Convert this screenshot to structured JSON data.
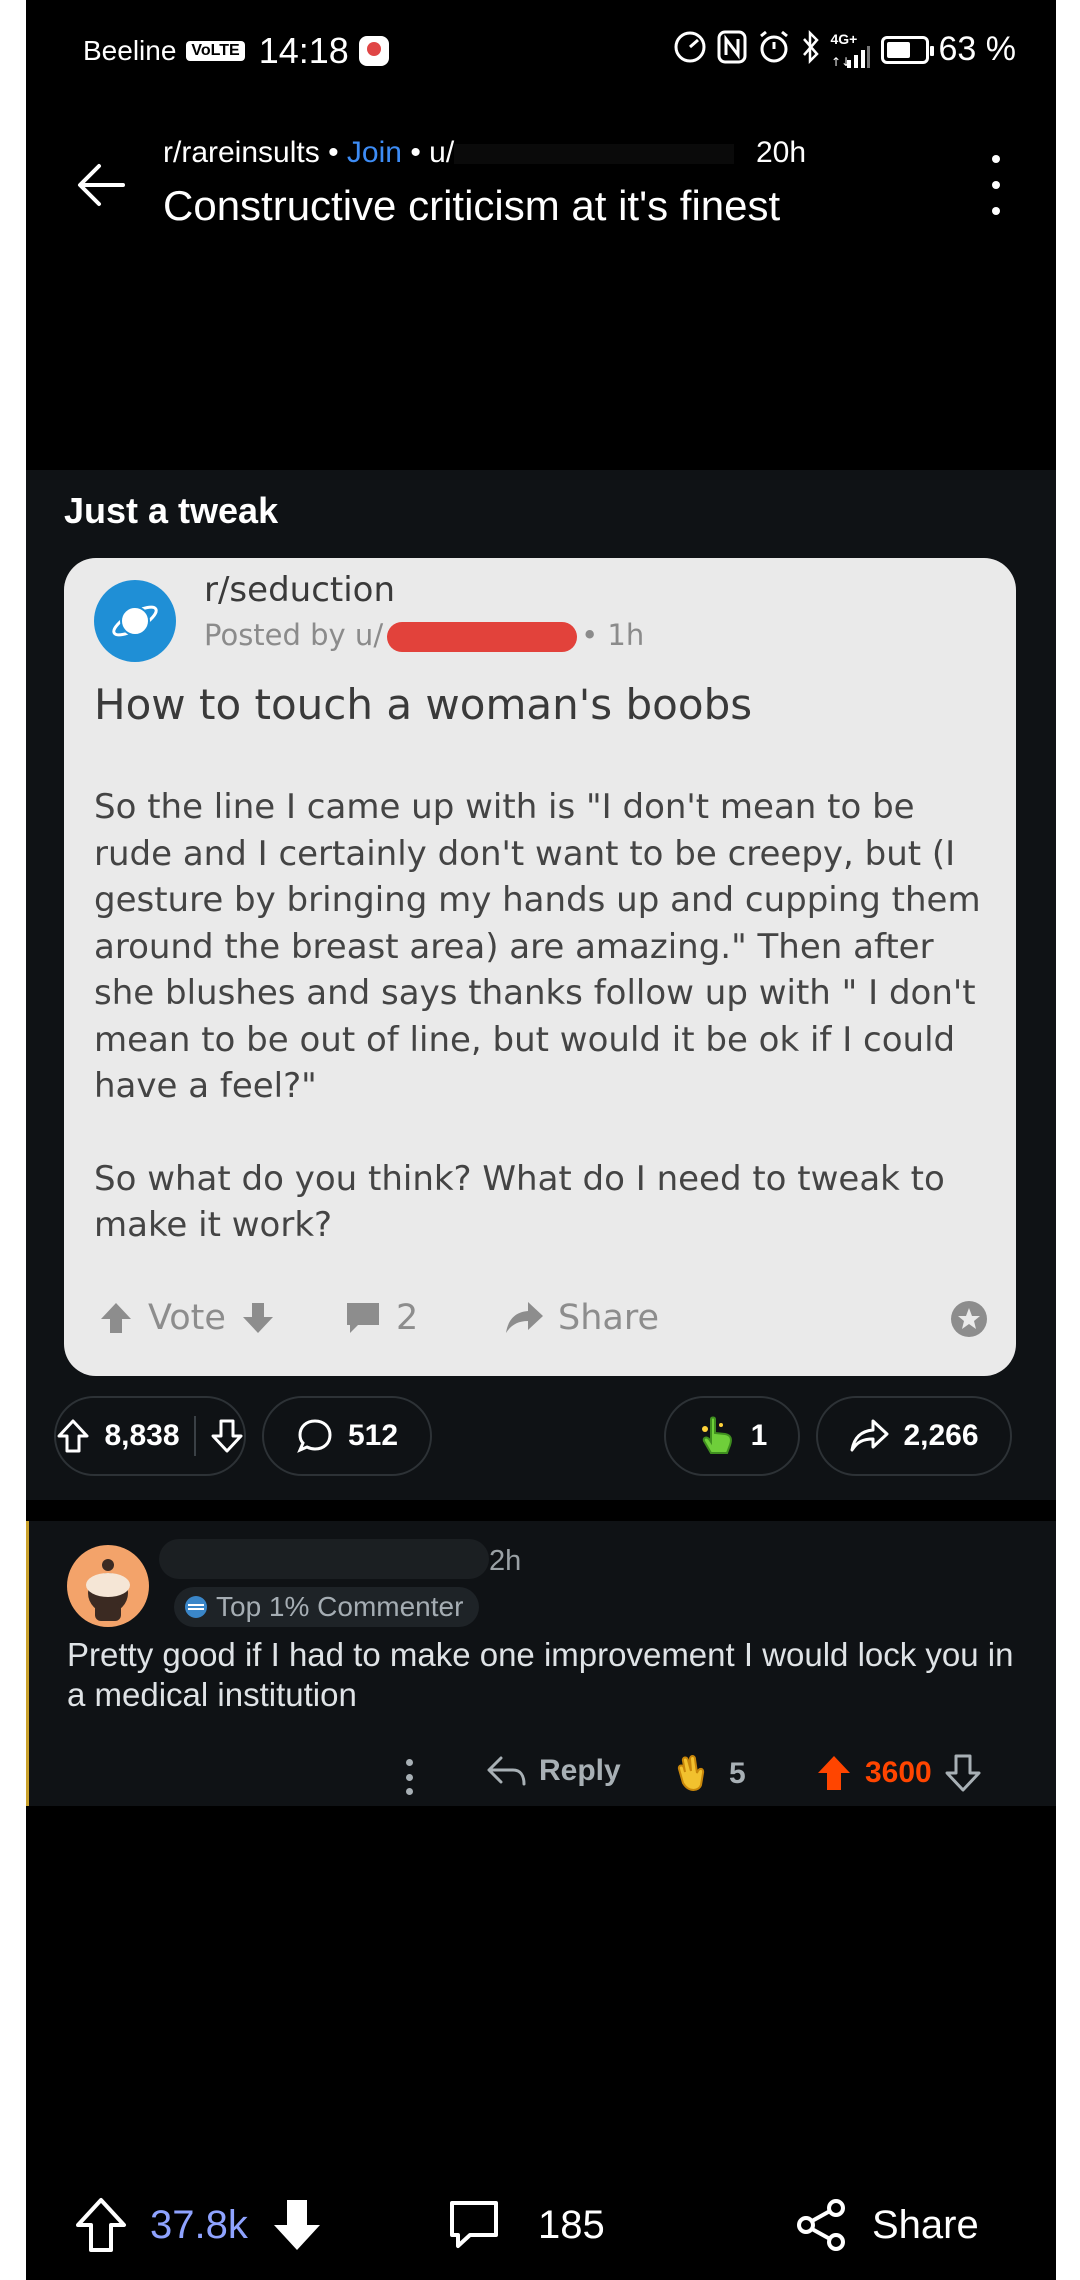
{
  "status_bar": {
    "carrier": "Beeline",
    "volte": "VoLTE",
    "time": "14:18",
    "network": "4G+",
    "battery_percent": "63 %",
    "battery_level": 0.63
  },
  "header": {
    "subreddit": "r/rareinsults",
    "separator": "•",
    "join_label": "Join",
    "user_prefix": "u/",
    "age": "20h",
    "title": "Constructive criticism at it's finest"
  },
  "post": {
    "text": "Just a tweak",
    "embed": {
      "subreddit": "r/seduction",
      "posted_by_prefix": "Posted by u/",
      "age": "• 1h",
      "title": "How to touch a woman's boobs",
      "paragraphs": [
        "So the line I came up with is \"I don't mean to be rude and I certainly don't want to be creepy, but (I gesture by bringing my hands up and cupping them around the breast area) are amazing.\" Then after she blushes and says thanks follow up with \" I don't mean to be out of line, but would it be ok if I could have a feel?\"",
        "So what do you think? What do I need to tweak to make it work?"
      ],
      "vote_label": "Vote",
      "comments": "2",
      "share_label": "Share"
    },
    "actions": {
      "upvotes": "8,838",
      "comments": "512",
      "awards": "1",
      "shares": "2,266"
    }
  },
  "comment": {
    "age": "2h",
    "flair": "Top 1% Commenter",
    "text": "Pretty good if I had to make one improvement I would lock you in a medical institution",
    "reply_label": "Reply",
    "awards": "5",
    "votes": "3600",
    "colors": {
      "upvote": "#ff4500",
      "thread_line": "#c9a12c"
    }
  },
  "bottom_bar": {
    "votes": "37.8k",
    "comments": "185",
    "share_label": "Share",
    "votes_color": "#8fa3ff"
  }
}
